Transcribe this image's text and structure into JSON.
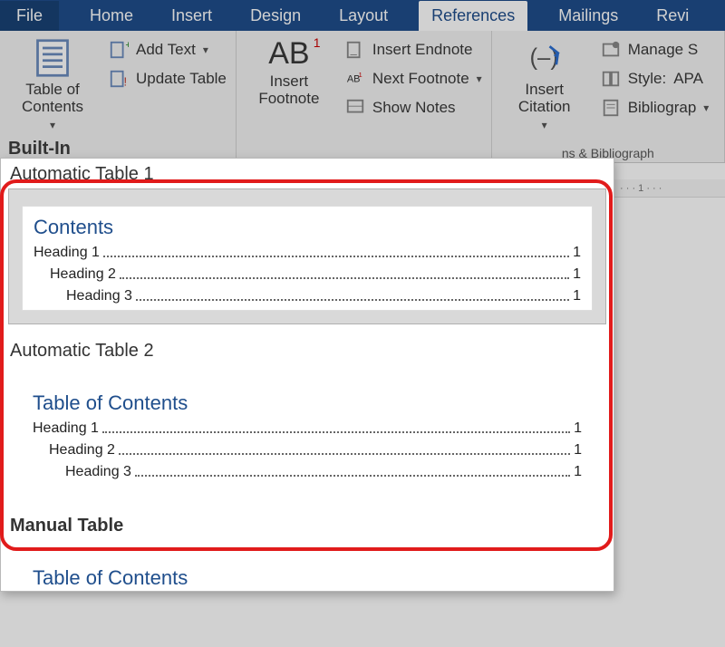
{
  "tabs": {
    "file": "File",
    "home": "Home",
    "insert": "Insert",
    "design": "Design",
    "layout": "Layout",
    "references": "References",
    "mailings": "Mailings",
    "review": "Revi"
  },
  "ribbon": {
    "toc": {
      "button": "Table of\nContents",
      "add_text": "Add Text",
      "update_table": "Update Table"
    },
    "footnotes": {
      "insert_footnote": "Insert\nFootnote",
      "ab_label": "AB",
      "ab_sup": "1",
      "insert_endnote": "Insert Endnote",
      "next_footnote": "Next Footnote",
      "show_notes": "Show Notes"
    },
    "citations": {
      "insert_citation": "Insert\nCitation",
      "manage_sources": "Manage S",
      "style_label": "Style:",
      "style_value": "APA",
      "bibliography": "Bibliograp",
      "group_label": "ns & Bibliograph"
    }
  },
  "gallery": {
    "header": "Built-In",
    "option1": {
      "category": "Automatic Table 1",
      "title": "Contents",
      "rows": [
        {
          "text": "Heading 1",
          "page": "1",
          "indent": 0
        },
        {
          "text": "Heading 2",
          "page": "1",
          "indent": 1
        },
        {
          "text": "Heading 3",
          "page": "1",
          "indent": 2
        }
      ]
    },
    "option2": {
      "category": "Automatic Table 2",
      "title": "Table of Contents",
      "rows": [
        {
          "text": "Heading 1",
          "page": "1",
          "indent": 0
        },
        {
          "text": "Heading 2",
          "page": "1",
          "indent": 1
        },
        {
          "text": "Heading 3",
          "page": "1",
          "indent": 2
        }
      ]
    },
    "option3": {
      "category": "Manual Table",
      "title": "Table of Contents"
    }
  },
  "ruler": "·  ·  ·  1  ·  ·  ·"
}
